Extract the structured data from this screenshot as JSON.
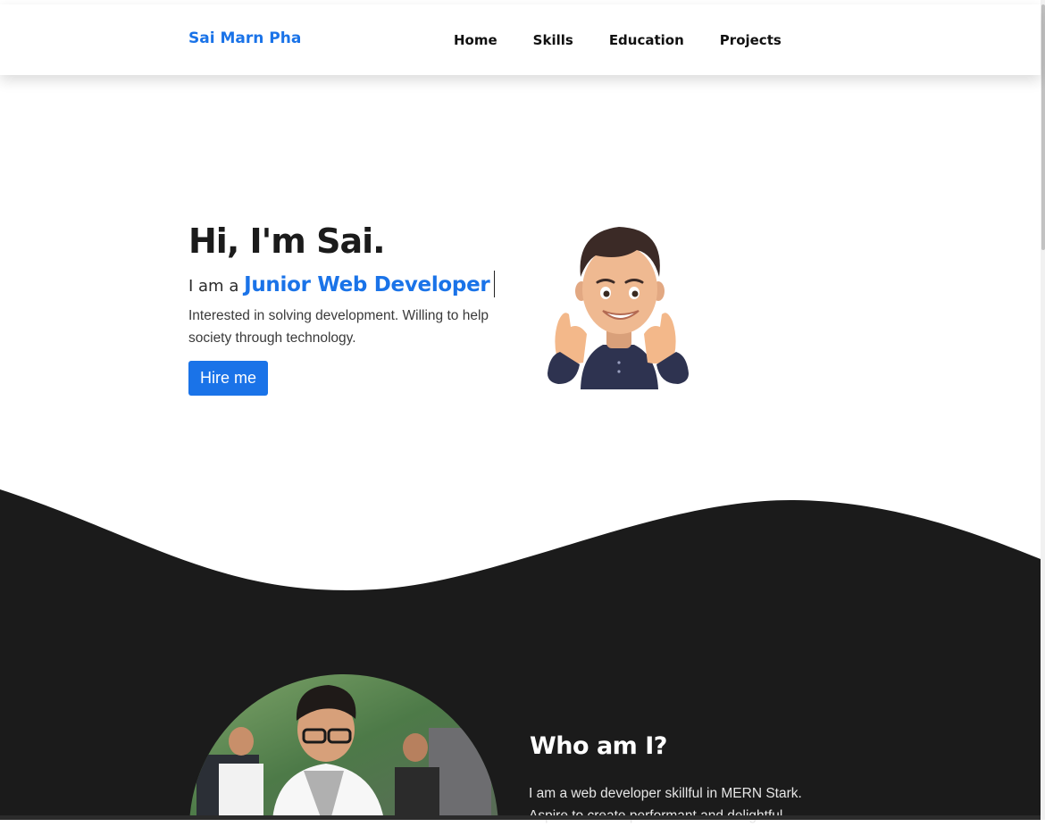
{
  "navbar": {
    "brand": "Sai Marn Pha",
    "links": [
      "Home",
      "Skills",
      "Education",
      "Projects"
    ]
  },
  "hero": {
    "title": "Hi, I'm Sai.",
    "subtitle_prefix": "I am a",
    "role": "Junior Web Developer",
    "description": "Interested in solving development. Willing to help society through technology.",
    "button": "Hire me"
  },
  "about": {
    "title": "Who am I?",
    "text": "I am a web developer skillful in MERN Stark. Aspire to create performant and delightful"
  },
  "colors": {
    "accent": "#1a73e8",
    "dark_section": "#1b1b1b",
    "text_dark": "#1b1b1b"
  },
  "icons": {
    "avatar": "thumbs-up-memoji-icon",
    "profile_photo": "profile-photo"
  }
}
